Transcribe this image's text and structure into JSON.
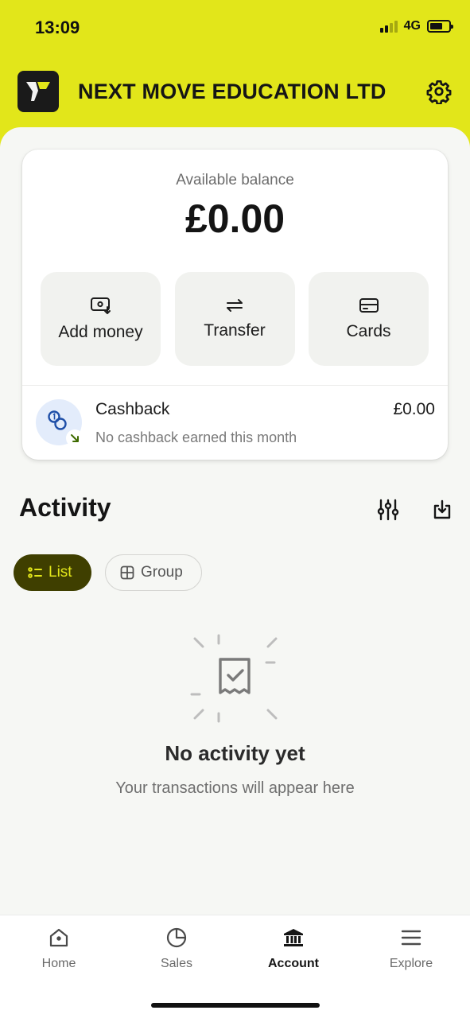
{
  "status_bar": {
    "time": "13:09",
    "network": "4G"
  },
  "header": {
    "company_name": "NEXT MOVE EDUCATION LTD",
    "logo_icon": "yapily-logo",
    "settings_icon": "gear-icon"
  },
  "balance": {
    "label": "Available balance",
    "amount": "£0.00",
    "actions": [
      {
        "label": "Add money",
        "icon": "add-money-icon"
      },
      {
        "label": "Transfer",
        "icon": "transfer-arrows-icon"
      },
      {
        "label": "Cards",
        "icon": "card-icon"
      }
    ],
    "cashback": {
      "title": "Cashback",
      "subtitle": "No cashback earned this month",
      "amount": "£0.00"
    }
  },
  "activity": {
    "title": "Activity",
    "view_toggle": {
      "list_label": "List",
      "group_label": "Group",
      "selected": "List"
    },
    "empty_title": "No activity yet",
    "empty_subtitle": "Your transactions will appear here"
  },
  "bottom_nav": [
    {
      "label": "Home",
      "icon": "home-icon"
    },
    {
      "label": "Sales",
      "icon": "pie-chart-icon"
    },
    {
      "label": "Account",
      "icon": "bank-icon",
      "active": true
    },
    {
      "label": "Explore",
      "icon": "menu-icon"
    }
  ],
  "colors": {
    "brand": "#e2e61a",
    "dark_accent": "#3f3f00",
    "background": "#f6f7f4"
  }
}
